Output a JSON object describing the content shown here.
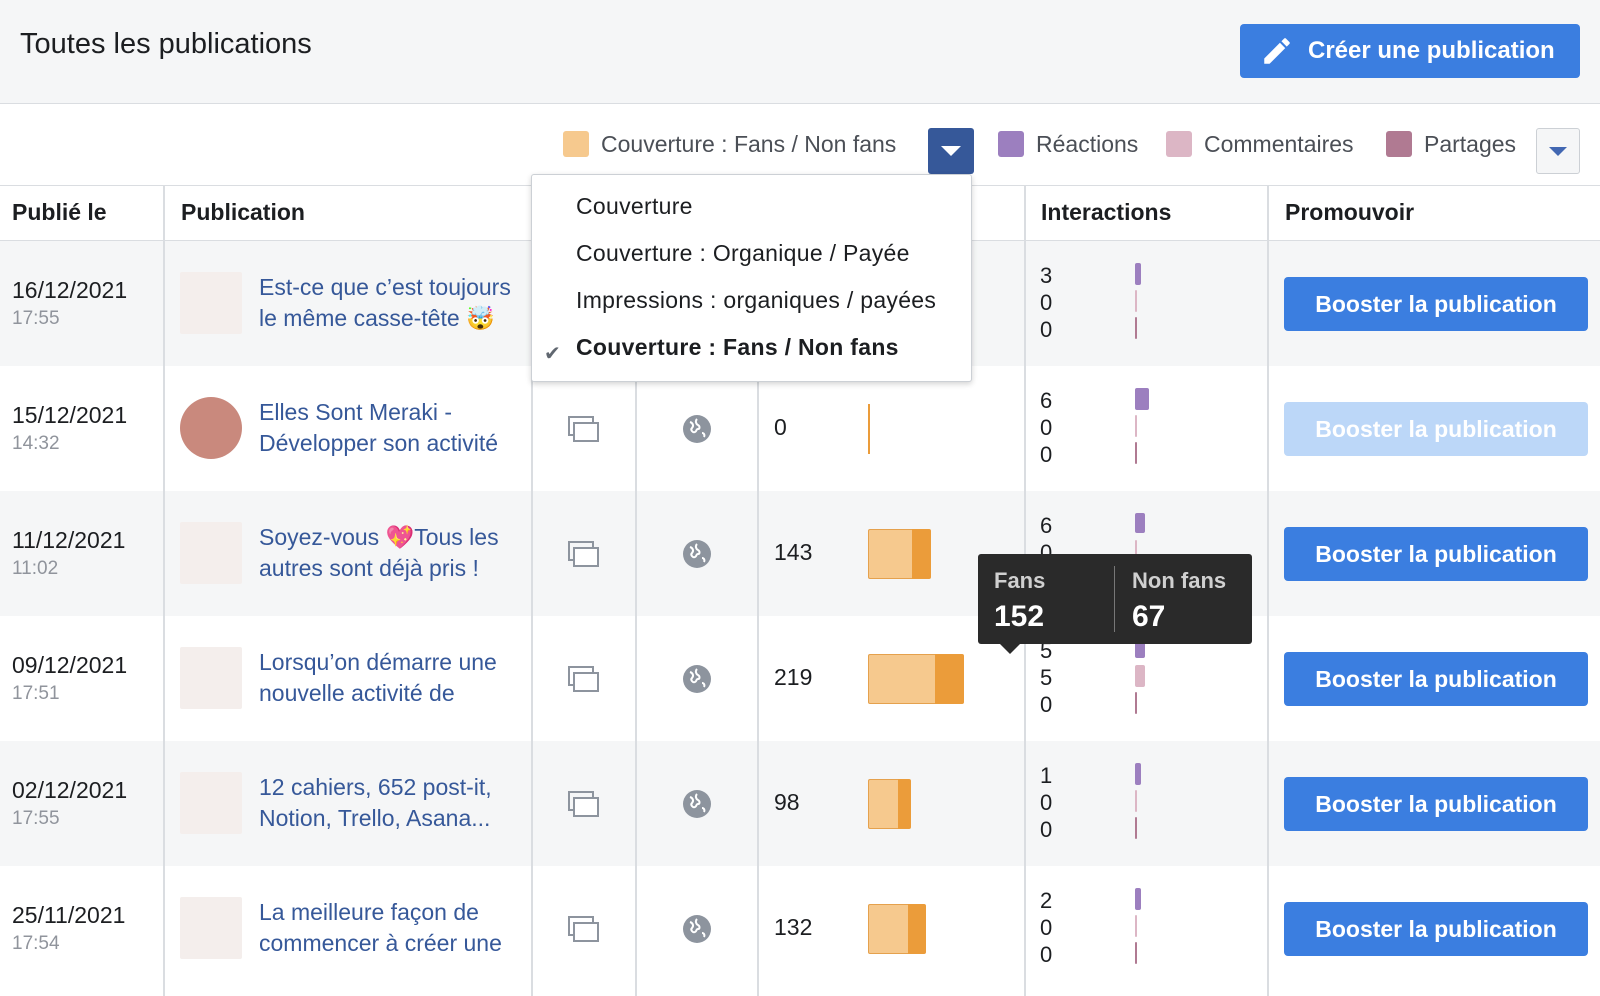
{
  "header": {
    "title": "Toutes les publications",
    "create_button": "Créer une publication"
  },
  "legend": {
    "metric_label": "Couverture : Fans / Non fans",
    "reactions": "Réactions",
    "comments": "Commentaires",
    "shares": "Partages",
    "colors": {
      "fans": "#f6c98e",
      "non_fans": "#eb9c3a",
      "reactions": "#9c7fbf",
      "comments": "#dcb6c5",
      "shares": "#b07a92"
    }
  },
  "columns": {
    "published": "Publié le",
    "publication": "Publication",
    "interactions": "Interactions",
    "promote": "Promouvoir"
  },
  "dropdown": {
    "items": [
      "Couverture",
      "Couverture : Organique / Payée",
      "Impressions : organiques / payées",
      "Couverture : Fans / Non fans"
    ],
    "selected_index": 3
  },
  "tooltip": {
    "fans_label": "Fans",
    "fans_value": "152",
    "nonfans_label": "Non fans",
    "nonfans_value": "67"
  },
  "rows": [
    {
      "date": "16/12/2021",
      "time": "17:55",
      "title": "Est-ce que c’est toujours le même casse-tête 🤯",
      "reach": "",
      "fans": 0,
      "nonfans": 0,
      "interactions": [
        "3",
        "0",
        "0"
      ],
      "boost": "Booster la publication",
      "boost_enabled": true
    },
    {
      "date": "15/12/2021",
      "time": "14:32",
      "title": "Elles Sont Meraki - Développer son activité",
      "reach": "0",
      "fans": 0,
      "nonfans": 0,
      "interactions": [
        "6",
        "0",
        "0"
      ],
      "boost": "Booster la publication",
      "boost_enabled": false
    },
    {
      "date": "11/12/2021",
      "time": "11:02",
      "title": "Soyez-vous 💖Tous les autres sont déjà pris !",
      "reach": "143",
      "fans": 100,
      "nonfans": 43,
      "interactions": [
        "6",
        "0",
        ""
      ],
      "boost": "Booster la publication",
      "boost_enabled": true
    },
    {
      "date": "09/12/2021",
      "time": "17:51",
      "title": "Lorsqu’on démarre une nouvelle activité de",
      "reach": "219",
      "fans": 152,
      "nonfans": 67,
      "interactions": [
        "5",
        "5",
        "0"
      ],
      "boost": "Booster la publication",
      "boost_enabled": true
    },
    {
      "date": "02/12/2021",
      "time": "17:55",
      "title": "12 cahiers, 652 post-it, Notion, Trello, Asana...",
      "reach": "98",
      "fans": 68,
      "nonfans": 30,
      "interactions": [
        "1",
        "0",
        "0"
      ],
      "boost": "Booster la publication",
      "boost_enabled": true
    },
    {
      "date": "25/11/2021",
      "time": "17:54",
      "title": "La meilleure façon de commencer à créer une",
      "reach": "132",
      "fans": 92,
      "nonfans": 40,
      "interactions": [
        "2",
        "0",
        "0"
      ],
      "boost": "Booster la publication",
      "boost_enabled": true
    }
  ]
}
